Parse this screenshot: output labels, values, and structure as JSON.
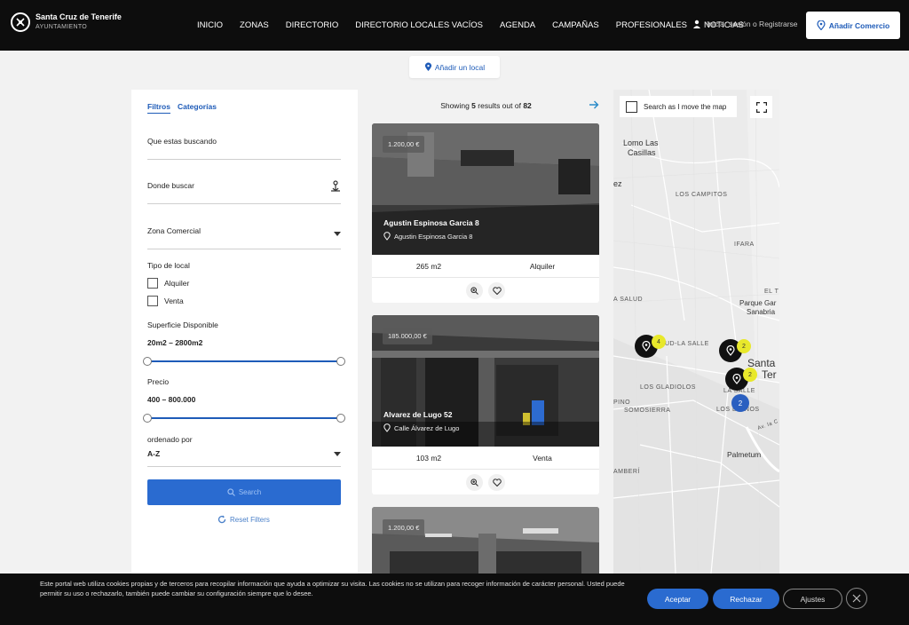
{
  "header": {
    "logo_line1": "Santa Cruz de Tenerife",
    "logo_line2": "AYUNTAMIENTO",
    "nav": [
      "INICIO",
      "ZONAS",
      "DIRECTORIO",
      "DIRECTORIO LOCALES VACÍOS",
      "AGENDA",
      "CAMPAÑAS",
      "PROFESIONALES",
      "NOTICIAS"
    ],
    "login": "Iniciar sesión o Registrarse",
    "add_commerce": "Añadir Comercio"
  },
  "add_local": "Añadir un local",
  "filters": {
    "tab_filters": "Filtros",
    "tab_categories": "Categorías",
    "what_placeholder": "Que estas buscando",
    "where_placeholder": "Donde buscar",
    "zone_label": "Zona Comercial",
    "type_label": "Tipo de local",
    "type_options": [
      "Alquiler",
      "Venta"
    ],
    "surface_label": "Superficie Disponible",
    "surface_value": "20m2 – 2800m2",
    "surface_range": {
      "min": 0,
      "max": 1
    },
    "price_label": "Precio",
    "price_value": "400 – 800.000",
    "price_range": {
      "min": 0,
      "max": 1
    },
    "sort_label": "ordenado por",
    "sort_value": "A-Z",
    "search_button": "Search",
    "reset": "Reset Filters"
  },
  "results": {
    "showing_prefix": "Showing",
    "count": "5",
    "middle": "results out of",
    "total": "82",
    "cards": [
      {
        "price": "1.200,00 €",
        "title": "Agustin Espinosa Garcia 8",
        "address": "Agustin Espinosa Garcia 8",
        "area": "265 m2",
        "type": "Alquiler"
      },
      {
        "price": "185.000,00 €",
        "title": "Alvarez de Lugo 52",
        "address": "Calle Álvarez de Lugo",
        "area": "103 m2",
        "type": "Venta"
      },
      {
        "price": "1.200,00 €",
        "title": "",
        "address": "",
        "area": "",
        "type": ""
      }
    ]
  },
  "map": {
    "search_move": "Search as I move the map",
    "labels": {
      "lomo": "Lomo Las",
      "casillas": "Casillas",
      "ez": "ez",
      "campitos": "LOS CAMPITOS",
      "ifara": "IFARA",
      "salud": "A SALUD",
      "el_t": "EL T",
      "parque": "Parque Gar",
      "sanabria": "Sanabria",
      "santa": "Santa",
      "ter": "Ter",
      "lasalle1": "UD-LA SALLE",
      "gladiolos": "LOS GLADIOLOS",
      "lasalle2": "LA SALLE",
      "pino": "PINO",
      "somosierra": "SOMOSIERRA",
      "llanos": "LOS LLANOS",
      "palmetum": "Palmetum",
      "amberi": "AMBERÍ",
      "avla": "Av. la C"
    },
    "cluster_blue": "2",
    "cluster_yellow": [
      "4",
      "2",
      "2"
    ]
  },
  "cookie": {
    "text": "Este portal web utiliza cookies propias y de terceros para recopilar información que ayuda a optimizar su visita. Las cookies no se utilizan para recoger información de carácter personal. Usted puede permitir su uso o rechazarlo, también puede cambiar su configuración siempre que lo desee.",
    "accept": "Aceptar",
    "reject": "Rechazar",
    "settings": "Ajustes"
  }
}
